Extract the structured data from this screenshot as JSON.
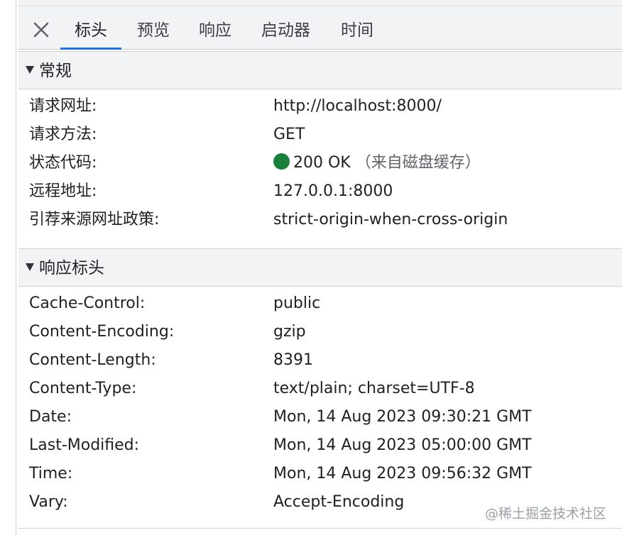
{
  "tabs": {
    "close_icon": "close-icon",
    "items": [
      "标头",
      "预览",
      "响应",
      "启动器",
      "时间"
    ],
    "active": "标头"
  },
  "general": {
    "title": "常规",
    "rows": [
      {
        "key": "请求网址:",
        "value": "http://localhost:8000/"
      },
      {
        "key": "请求方法:",
        "value": "GET"
      },
      {
        "key": "状态代码:",
        "value": "200 OK",
        "extra": "（来自磁盘缓存）"
      },
      {
        "key": "远程地址:",
        "value": "127.0.0.1:8000"
      },
      {
        "key": "引荐来源网址政策:",
        "value": "strict-origin-when-cross-origin"
      }
    ]
  },
  "response_headers": {
    "title": "响应标头",
    "rows": [
      {
        "key": "Cache-Control:",
        "value": "public"
      },
      {
        "key": "Content-Encoding:",
        "value": "gzip"
      },
      {
        "key": "Content-Length:",
        "value": "8391"
      },
      {
        "key": "Content-Type:",
        "value": "text/plain; charset=UTF-8"
      },
      {
        "key": "Date:",
        "value": "Mon, 14 Aug 2023 09:30:21 GMT"
      },
      {
        "key": "Last-Modified:",
        "value": "Mon, 14 Aug 2023 05:00:00 GMT"
      },
      {
        "key": "Time:",
        "value": "Mon, 14 Aug 2023 09:56:32 GMT"
      },
      {
        "key": "Vary:",
        "value": "Accept-Encoding"
      }
    ]
  },
  "colors": {
    "status_ok": "#188038",
    "accent": "#1a73e8"
  },
  "watermark": "@稀土掘金技术社区"
}
